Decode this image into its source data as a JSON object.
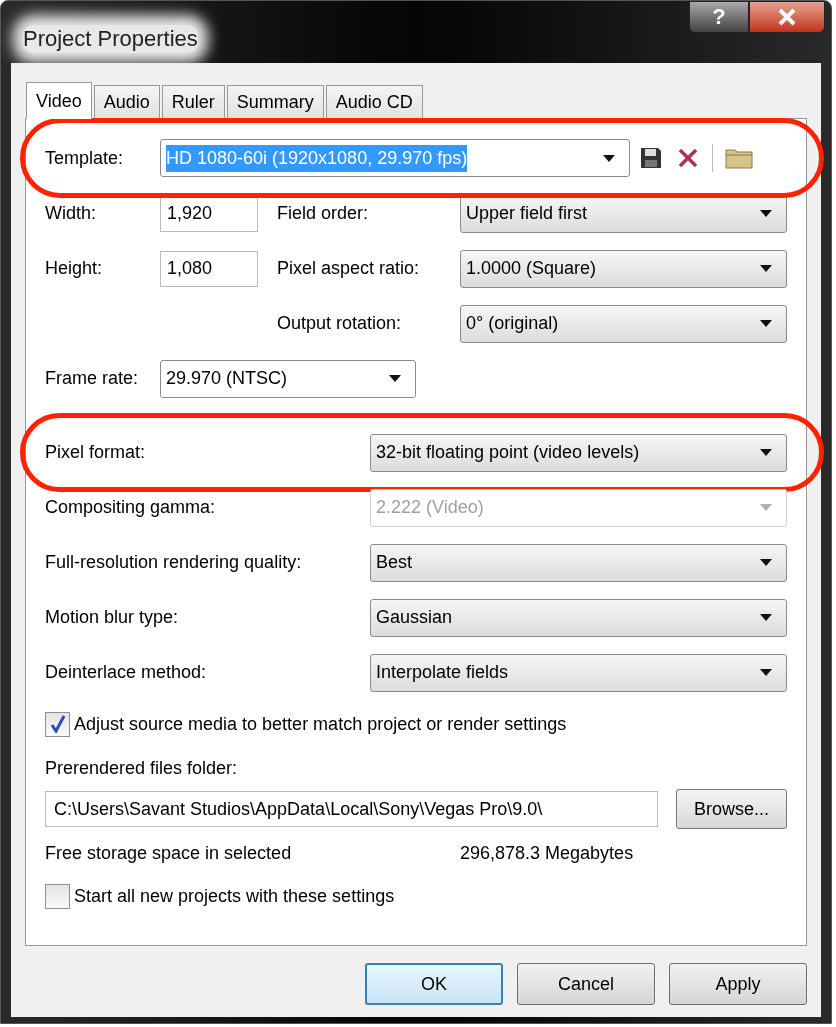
{
  "window": {
    "title": "Project Properties"
  },
  "title_buttons": [
    {
      "kind": "help",
      "label": "?"
    },
    {
      "kind": "close"
    }
  ],
  "tabs": [
    {
      "label": "Video",
      "selected": true
    },
    {
      "label": "Audio",
      "selected": false
    },
    {
      "label": "Ruler",
      "selected": false
    },
    {
      "label": "Summary",
      "selected": false
    },
    {
      "label": "Audio CD",
      "selected": false
    }
  ],
  "template": {
    "label": "Template:",
    "value": "HD 1080-60i (1920x1080, 29.970 fps)",
    "highlighted": true
  },
  "size_fields": [
    {
      "label": "Width:",
      "value": "1,920"
    },
    {
      "label": "Height:",
      "value": "1,080"
    }
  ],
  "right_fields": [
    {
      "label": "Field order:",
      "value": "Upper field first"
    },
    {
      "label": "Pixel aspect ratio:",
      "value": "1.0000 (Square)"
    },
    {
      "label": "Output rotation:",
      "value": "0° (original)"
    }
  ],
  "frame_rate": {
    "label": "Frame rate:",
    "value": "29.970 (NTSC)"
  },
  "settings": [
    {
      "label": "Pixel format:",
      "value": "32-bit floating point (video levels)",
      "disabled": false,
      "highlighted": true
    },
    {
      "label": "Compositing gamma:",
      "value": "2.222 (Video)",
      "disabled": true,
      "highlighted": false
    },
    {
      "label": "Full-resolution rendering quality:",
      "value": "Best",
      "disabled": false,
      "highlighted": false
    },
    {
      "label": "Motion blur type:",
      "value": "Gaussian",
      "disabled": false,
      "highlighted": false
    },
    {
      "label": "Deinterlace method:",
      "value": "Interpolate fields",
      "disabled": false,
      "highlighted": false
    }
  ],
  "adjust_checkbox": {
    "label": "Adjust source media to better match project or render settings",
    "checked": true
  },
  "prerender": {
    "label": "Prerendered files folder:",
    "value": "C:\\Users\\Savant Studios\\AppData\\Local\\Sony\\Vegas Pro\\9.0\\",
    "button": "Browse..."
  },
  "free_storage": {
    "label": "Free storage space in selected",
    "value": "296,878.3 Megabytes"
  },
  "start_checkbox": {
    "label": "Start all new projects with these settings",
    "checked": false
  },
  "buttons": [
    {
      "label": "OK",
      "default": true
    },
    {
      "label": "Cancel",
      "default": false
    },
    {
      "label": "Apply",
      "default": false
    }
  ]
}
